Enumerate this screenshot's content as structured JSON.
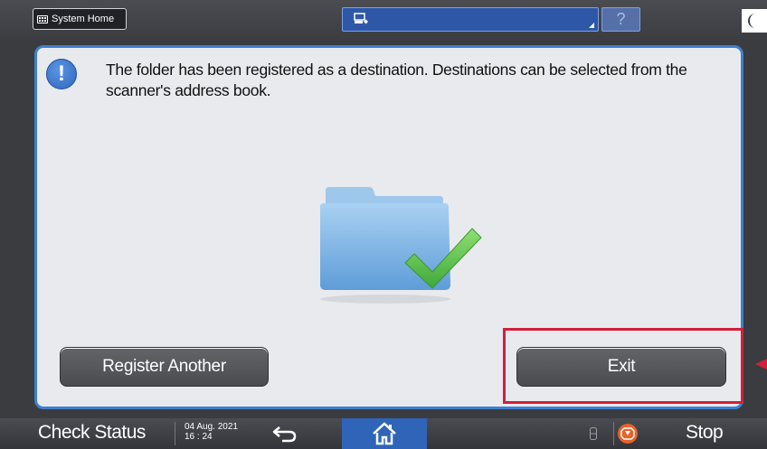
{
  "topbar": {
    "system_home_label": "System Home",
    "help_label": "?"
  },
  "dialog": {
    "message": "The folder has been registered as a destination. Destinations can be selected from the scanner's address book.",
    "info_icon_glyph": "!",
    "register_another_label": "Register Another",
    "exit_label": "Exit"
  },
  "bottombar": {
    "check_status_label": "Check Status",
    "date": "04 Aug. 2021",
    "time": "16 : 24",
    "stop_label": "Stop"
  },
  "colors": {
    "accent_blue": "#2f64b8",
    "highlight_red": "#d1203a",
    "dialog_border": "#3d7fd1"
  },
  "icons": [
    "grid-icon",
    "scanner-icon",
    "help-icon",
    "moon-icon",
    "info-icon",
    "folder-check-icon",
    "back-icon",
    "home-icon",
    "memory-icon",
    "stop-icon"
  ]
}
